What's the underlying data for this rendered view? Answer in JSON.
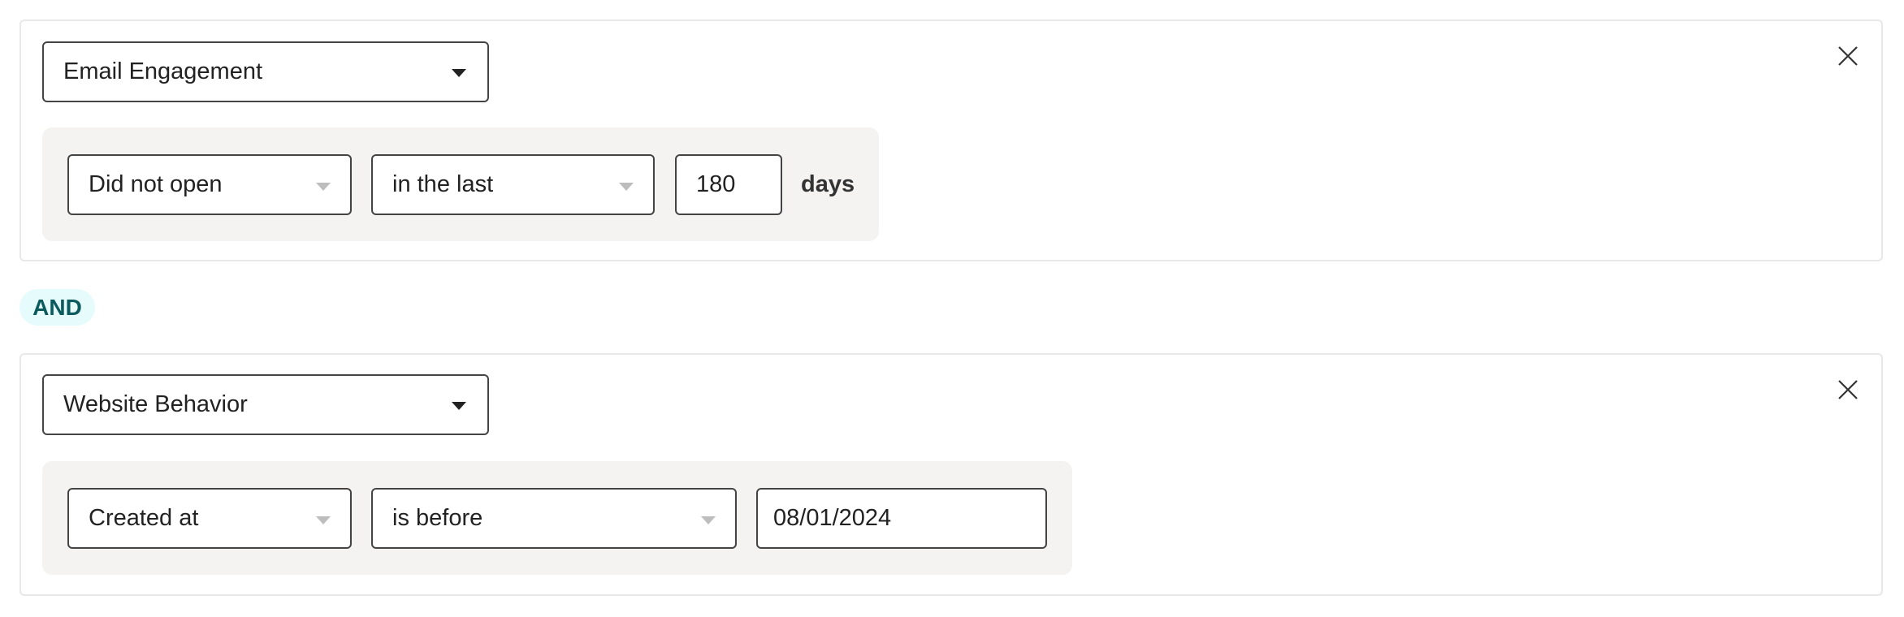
{
  "conditions": [
    {
      "category": "Email Engagement",
      "action": "Did not open",
      "operator": "in the last",
      "value": "180",
      "unit": "days",
      "close_icon": "close-icon"
    },
    {
      "category": "Website Behavior",
      "action": "Created at",
      "operator": "is before",
      "value": "08/01/2024",
      "close_icon": "close-icon"
    }
  ],
  "connector": "AND",
  "colors": {
    "connector_bg": "#e6fbfb",
    "connector_text": "#0b5a5e",
    "panel_bg": "#f4f3f2"
  }
}
